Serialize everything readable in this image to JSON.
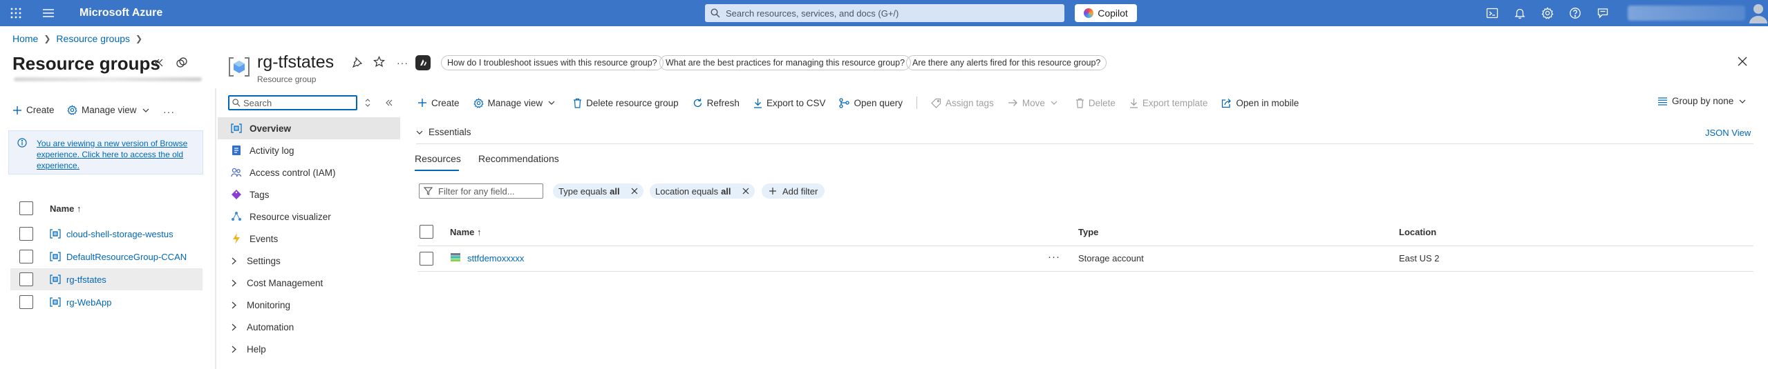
{
  "topbar": {
    "brand": "Microsoft Azure",
    "search_placeholder": "Search resources, services, and docs (G+/)",
    "copilot_label": "Copilot"
  },
  "breadcrumb": [
    "Home",
    "Resource groups"
  ],
  "left": {
    "title": "Resource groups",
    "commands": {
      "create": "Create",
      "manage_view": "Manage view"
    },
    "info": "You are viewing a new version of Browse experience. Click here to access the old experience.",
    "name_header": "Name ↑",
    "groups": [
      {
        "name": "cloud-shell-storage-westus",
        "selected": false
      },
      {
        "name": "DefaultResourceGroup-CCAN",
        "selected": false
      },
      {
        "name": "rg-tfstates",
        "selected": true
      },
      {
        "name": "rg-WebApp",
        "selected": false
      }
    ]
  },
  "blade": {
    "title": "rg-tfstates",
    "subtitle": "Resource group",
    "questions": [
      "How do I troubleshoot issues with this resource group?",
      "What are the best practices for managing this resource group?",
      "Are there any alerts fired for this resource group?"
    ]
  },
  "menu": {
    "search_placeholder": "Search",
    "items": [
      {
        "label": "Overview",
        "icon": "overview-icon",
        "expandable": false,
        "active": true
      },
      {
        "label": "Activity log",
        "icon": "activity-log-icon",
        "expandable": false
      },
      {
        "label": "Access control (IAM)",
        "icon": "iam-icon",
        "expandable": false
      },
      {
        "label": "Tags",
        "icon": "tag-icon",
        "expandable": false
      },
      {
        "label": "Resource visualizer",
        "icon": "visualizer-icon",
        "expandable": false
      },
      {
        "label": "Events",
        "icon": "events-icon",
        "expandable": false
      },
      {
        "label": "Settings",
        "expandable": true
      },
      {
        "label": "Cost Management",
        "expandable": true
      },
      {
        "label": "Monitoring",
        "expandable": true
      },
      {
        "label": "Automation",
        "expandable": true
      },
      {
        "label": "Help",
        "expandable": true
      }
    ]
  },
  "toolbar": {
    "create": "Create",
    "manage_view": "Manage view",
    "delete_rg": "Delete resource group",
    "refresh": "Refresh",
    "export_csv": "Export to CSV",
    "open_query": "Open query",
    "assign_tags": "Assign tags",
    "move": "Move",
    "delete": "Delete",
    "export_template": "Export template",
    "open_mobile": "Open in mobile",
    "group_by": "Group by none"
  },
  "essentials": {
    "label": "Essentials",
    "json_view": "JSON View"
  },
  "tabs": {
    "resources": "Resources",
    "recommendations": "Recommendations"
  },
  "filters": {
    "placeholder": "Filter for any field...",
    "type_label": "Type equals",
    "type_value": "all",
    "location_label": "Location equals",
    "location_value": "all",
    "add_filter": "Add filter"
  },
  "table": {
    "headers": {
      "name": "Name ↑",
      "type": "Type",
      "location": "Location"
    },
    "rows": [
      {
        "name": "sttfdemoxxxxx",
        "type": "Storage account",
        "location": "East US 2",
        "more": "···"
      }
    ]
  }
}
